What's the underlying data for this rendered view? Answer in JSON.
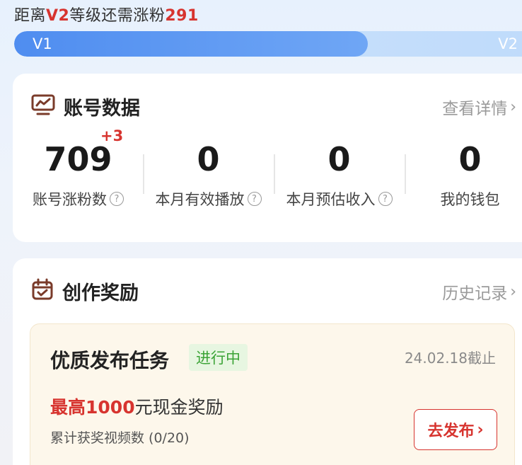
{
  "level": {
    "prefix": "距离",
    "target": "V2",
    "middle": "等级还需涨粉",
    "remaining": "291",
    "start_label": "V1",
    "end_label": "V2",
    "progress_fraction": 0.675
  },
  "account_data": {
    "title": "账号数据",
    "link_label": "查看详情",
    "stats": [
      {
        "value": "709",
        "label": "账号涨粉数",
        "delta": "+3",
        "has_help": true
      },
      {
        "value": "0",
        "label": "本月有效播放",
        "has_help": true
      },
      {
        "value": "0",
        "label": "本月预估收入",
        "has_help": true
      },
      {
        "value": "0",
        "label": "我的钱包",
        "has_help": false
      }
    ]
  },
  "creation_reward": {
    "title": "创作奖励",
    "link_label": "历史记录",
    "task": {
      "title": "优质发布任务",
      "status": "进行中",
      "deadline": "24.02.18截止",
      "reward_prefix": "最高",
      "reward_amount": "1000",
      "reward_suffix": "元现金奖励",
      "progress_text": "累计获奖视频数 (0/20)",
      "action_label": "去发布"
    }
  },
  "colors": {
    "accent_red": "#d7342f",
    "progress_blue": "#4f8df0",
    "status_green": "#3aa335"
  }
}
